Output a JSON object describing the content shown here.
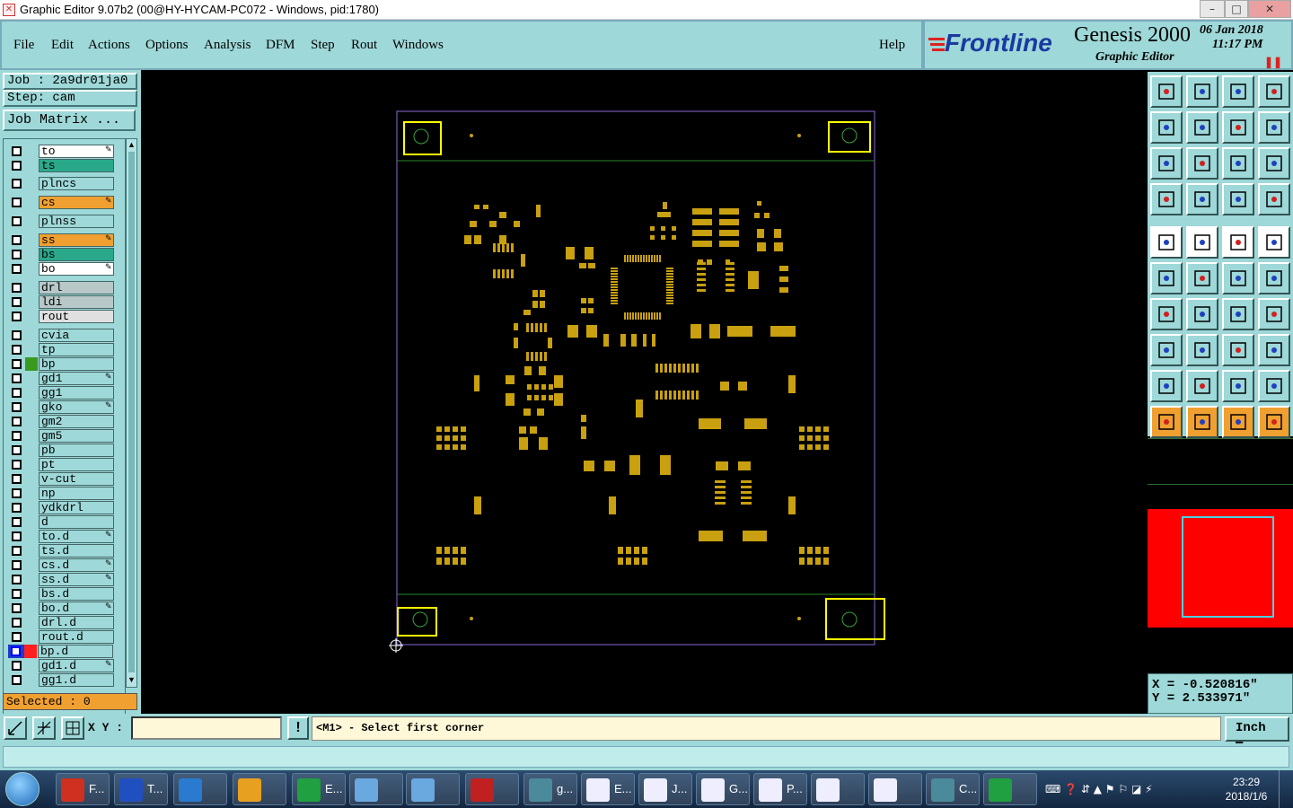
{
  "window": {
    "title": "Graphic Editor 9.07b2 (00@HY-HYCAM-PC072 - Windows, pid:1780)",
    "minimize": "–",
    "maximize": "□",
    "close": "✕"
  },
  "menu": {
    "items": [
      "File",
      "Edit",
      "Actions",
      "Options",
      "Analysis",
      "DFM",
      "Step",
      "Rout",
      "Windows"
    ],
    "help": "Help"
  },
  "brand": {
    "logo": "Frontline",
    "product": "Genesis 2000",
    "subtitle": "Graphic Editor",
    "date": "06 Jan 2018",
    "time": "11:17 PM"
  },
  "job": {
    "job": "Job : 2a9dr01ja0",
    "step": "Step: cam",
    "matrix_button": "Job Matrix ..."
  },
  "layers": [
    {
      "name": "to",
      "bg": "#ffffff",
      "edit": true
    },
    {
      "name": "ts",
      "bg": "#2aa88a",
      "edit": false
    },
    {
      "name": "plncs",
      "bg": "#9ed8d8",
      "edit": false
    },
    {
      "name": "cs",
      "bg": "#f0a030",
      "edit": true
    },
    {
      "name": "plnss",
      "bg": "#9ed8d8",
      "edit": false
    },
    {
      "name": "ss",
      "bg": "#f0a030",
      "edit": true
    },
    {
      "name": "bs",
      "bg": "#2aa88a",
      "edit": false
    },
    {
      "name": "bo",
      "bg": "#ffffff",
      "edit": true
    },
    {
      "name": "drl",
      "bg": "#b8c8c8",
      "edit": false
    },
    {
      "name": "ldi",
      "bg": "#b8c8c8",
      "edit": false
    },
    {
      "name": "rout",
      "bg": "#e0e0e0",
      "edit": false
    },
    {
      "name": "cvia",
      "bg": "#9ed8d8",
      "edit": false
    },
    {
      "name": "tp",
      "bg": "#9ed8d8",
      "edit": false
    },
    {
      "name": "bp",
      "bg": "#9ed8d8",
      "edit": false,
      "swatch": "#3a9a20"
    },
    {
      "name": "gd1",
      "bg": "#9ed8d8",
      "edit": true
    },
    {
      "name": "gg1",
      "bg": "#9ed8d8",
      "edit": false
    },
    {
      "name": "gko",
      "bg": "#9ed8d8",
      "edit": true
    },
    {
      "name": "gm2",
      "bg": "#9ed8d8",
      "edit": false
    },
    {
      "name": "gm5",
      "bg": "#9ed8d8",
      "edit": false
    },
    {
      "name": "pb",
      "bg": "#9ed8d8",
      "edit": false
    },
    {
      "name": "pt",
      "bg": "#9ed8d8",
      "edit": false
    },
    {
      "name": "v-cut",
      "bg": "#9ed8d8",
      "edit": false
    },
    {
      "name": "np",
      "bg": "#9ed8d8",
      "edit": false
    },
    {
      "name": "ydkdrl",
      "bg": "#9ed8d8",
      "edit": false
    },
    {
      "name": "d",
      "bg": "#9ed8d8",
      "edit": false
    },
    {
      "name": "to.d",
      "bg": "#9ed8d8",
      "edit": true
    },
    {
      "name": "ts.d",
      "bg": "#9ed8d8",
      "edit": false
    },
    {
      "name": "cs.d",
      "bg": "#9ed8d8",
      "edit": true
    },
    {
      "name": "ss.d",
      "bg": "#9ed8d8",
      "edit": true
    },
    {
      "name": "bs.d",
      "bg": "#9ed8d8",
      "edit": false
    },
    {
      "name": "bo.d",
      "bg": "#9ed8d8",
      "edit": true
    },
    {
      "name": "drl.d",
      "bg": "#9ed8d8",
      "edit": false
    },
    {
      "name": "rout.d",
      "bg": "#9ed8d8",
      "edit": false
    },
    {
      "name": "bp.d",
      "bg": "#9ed8d8",
      "edit": false,
      "swatch": "#ff2020",
      "active": true
    },
    {
      "name": "gd1.d",
      "bg": "#9ed8d8",
      "edit": true
    },
    {
      "name": "gg1.d",
      "bg": "#9ed8d8",
      "edit": false
    }
  ],
  "selected": "Selected : 0",
  "coords": {
    "x": "X = -0.520816\"",
    "y": "Y = 2.533971\""
  },
  "status": {
    "xy_label": "X Y :",
    "xy_value": "",
    "message": "<M1> - Select first corner",
    "units": "Inch"
  },
  "taskbar": {
    "items": [
      "F...",
      "T...",
      "",
      "",
      "E...",
      "",
      "",
      "",
      "g...",
      "E...",
      "J...",
      "G...",
      "P...",
      "",
      "",
      "C...",
      ""
    ],
    "time": "23:29",
    "date": "2018/1/6"
  },
  "colors": {
    "pad": "#c8a010",
    "outline": "#8a6ad8",
    "frame": "#ffff00",
    "teal": "#9ed8d8"
  }
}
